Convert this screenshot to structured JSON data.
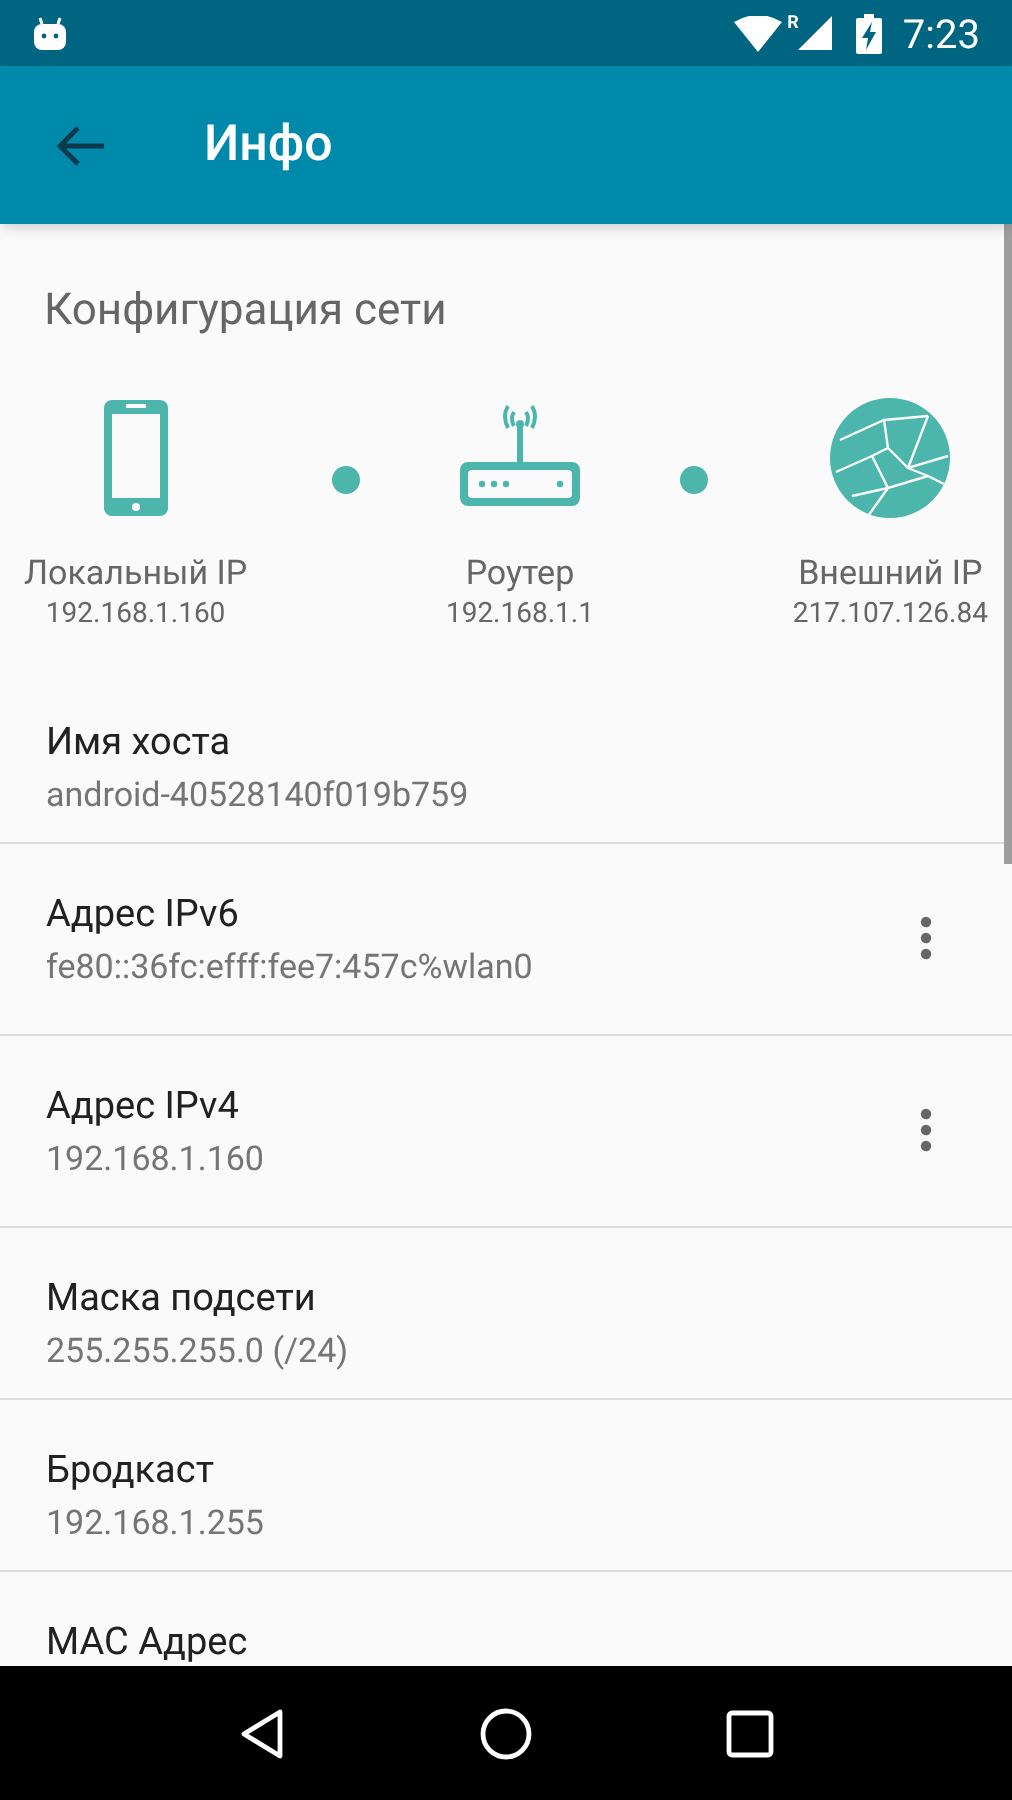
{
  "status_bar": {
    "time": "7:23",
    "roaming": "R"
  },
  "toolbar": {
    "title": "Инфо"
  },
  "network": {
    "title": "Конфигурация сети",
    "nodes": [
      {
        "kind": "phone",
        "label": "Локальный IP",
        "ip": "192.168.1.160"
      },
      {
        "kind": "router",
        "label": "Роутер",
        "ip": "192.168.1.1"
      },
      {
        "kind": "globe",
        "label": "Внешний IP",
        "ip": "217.107.126.84"
      }
    ]
  },
  "rows": [
    {
      "title": "Имя хоста",
      "value": "android-40528140f019b759",
      "has_menu": false
    },
    {
      "title": "Адрес IPv6",
      "value": "fe80::36fc:efff:fee7:457c%wlan0",
      "has_menu": true
    },
    {
      "title": "Адрес IPv4",
      "value": "192.168.1.160",
      "has_menu": true
    },
    {
      "title": "Маска подсети",
      "value": "255.255.255.0 (/24)",
      "has_menu": false
    },
    {
      "title": "Бродкаст",
      "value": "192.168.1.255",
      "has_menu": false
    },
    {
      "title": "MAC Адрес",
      "has_menu": false
    }
  ]
}
